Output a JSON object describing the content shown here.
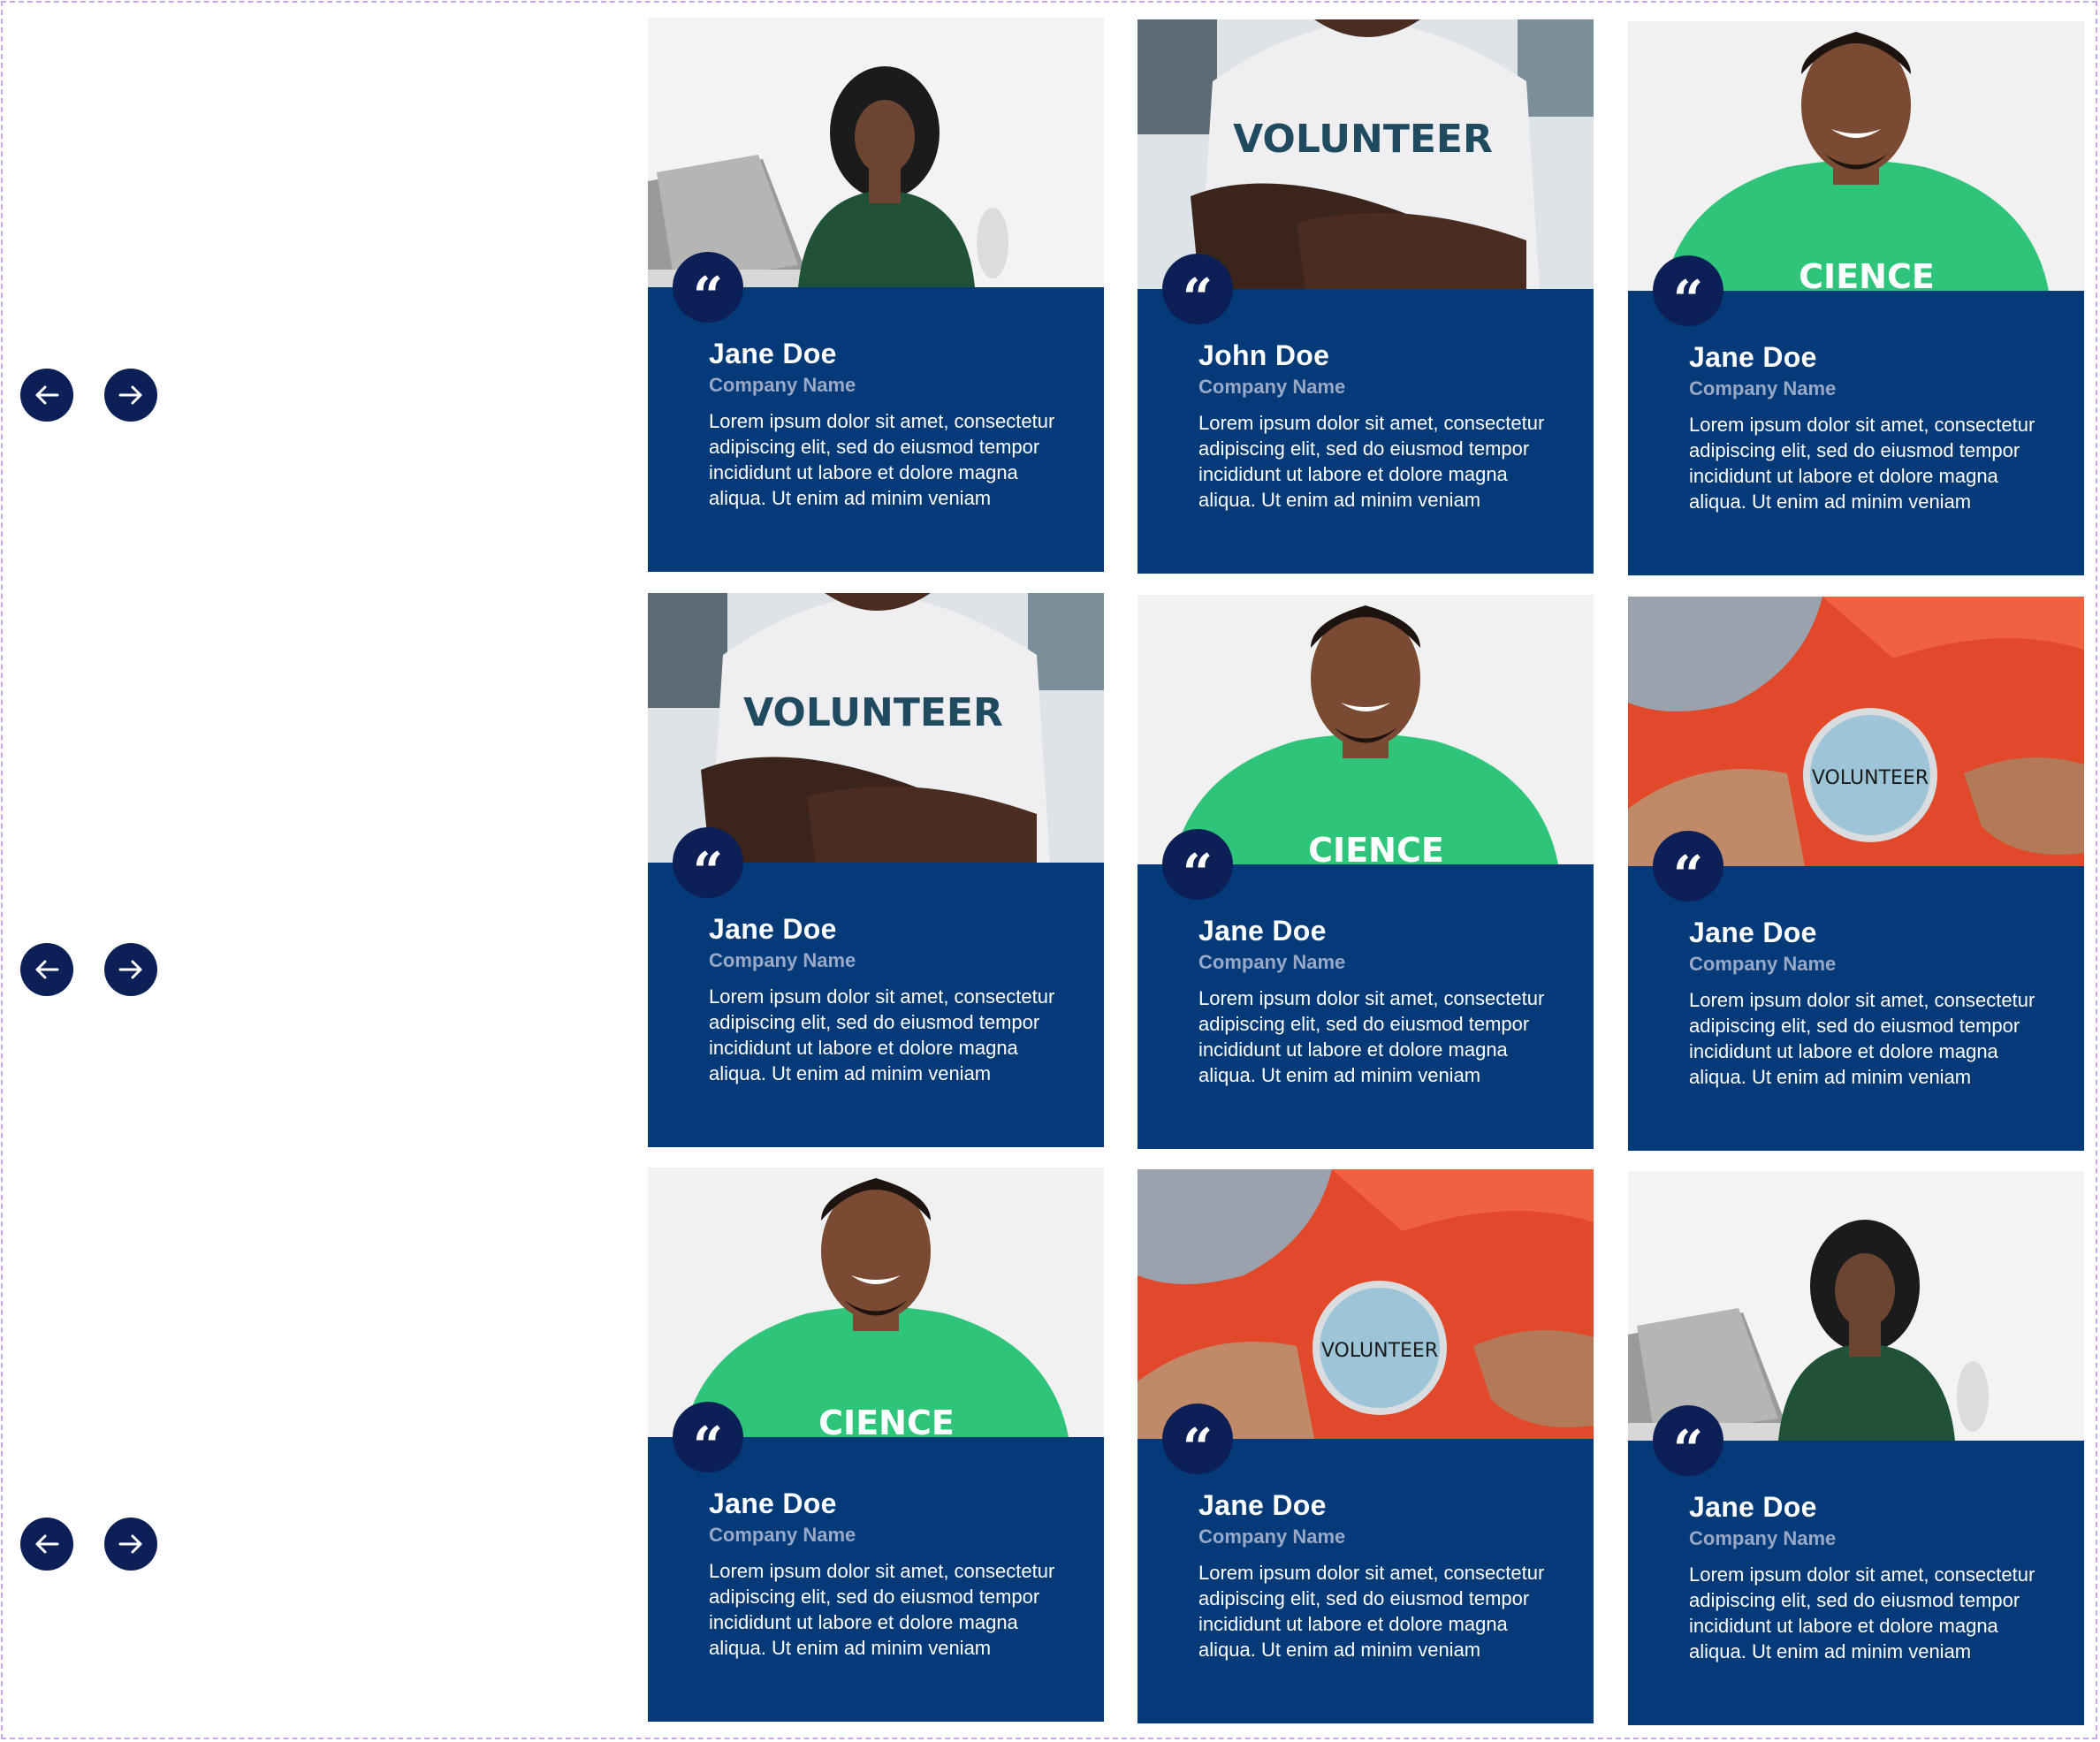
{
  "nav": {
    "prev_icon": "arrow-left-icon",
    "next_icon": "arrow-right-icon"
  },
  "quote_glyph": "“",
  "photos": {
    "woman_laptop": "woman-with-laptop-photo",
    "volunteer_shirt": "volunteer-shirt-photo",
    "science_shirt": "man-science-shirt-photo",
    "volunteer_badge": "volunteer-badge-photo"
  },
  "colors": {
    "card_bg": "#053a78",
    "badge_bg": "#0c1f57",
    "company": "#98a9c8"
  },
  "rows": [
    {
      "cards": [
        {
          "photo": "woman_laptop",
          "name": "Jane Doe",
          "company": "Company Name",
          "text": "Lorem ipsum dolor sit amet, consectetur adipiscing elit, sed do eiusmod tempor incididunt ut labore et dolore magna aliqua. Ut enim ad minim veniam"
        },
        {
          "photo": "volunteer_shirt",
          "name": "John Doe",
          "company": "Company Name",
          "text": "Lorem ipsum dolor sit amet, consectetur adipiscing elit, sed do eiusmod tempor incididunt ut labore et dolore magna aliqua. Ut enim ad minim veniam"
        },
        {
          "photo": "science_shirt",
          "name": "Jane Doe",
          "company": "Company Name",
          "text": "Lorem ipsum dolor sit amet, consectetur adipiscing elit, sed do eiusmod tempor incididunt ut labore et dolore magna aliqua. Ut enim ad minim veniam"
        }
      ]
    },
    {
      "cards": [
        {
          "photo": "volunteer_shirt",
          "name": "Jane Doe",
          "company": "Company Name",
          "text": "Lorem ipsum dolor sit amet, consectetur adipiscing elit, sed do eiusmod tempor incididunt ut labore et dolore magna aliqua. Ut enim ad minim veniam"
        },
        {
          "photo": "science_shirt",
          "name": "Jane Doe",
          "company": "Company Name",
          "text": "Lorem ipsum dolor sit amet, consectetur adipiscing elit, sed do eiusmod tempor incididunt ut labore et dolore magna aliqua. Ut enim ad minim veniam"
        },
        {
          "photo": "volunteer_badge",
          "name": "Jane Doe",
          "company": "Company Name",
          "text": "Lorem ipsum dolor sit amet, consectetur adipiscing elit, sed do eiusmod tempor incididunt ut labore et dolore magna aliqua. Ut enim ad minim veniam"
        }
      ]
    },
    {
      "cards": [
        {
          "photo": "science_shirt",
          "name": "Jane Doe",
          "company": "Company Name",
          "text": "Lorem ipsum dolor sit amet, consectetur adipiscing elit, sed do eiusmod tempor incididunt ut labore et dolore magna aliqua. Ut enim ad minim veniam"
        },
        {
          "photo": "volunteer_badge",
          "name": "Jane Doe",
          "company": "Company Name",
          "text": "Lorem ipsum dolor sit amet, consectetur adipiscing elit, sed do eiusmod tempor incididunt ut labore et dolore magna aliqua. Ut enim ad minim veniam"
        },
        {
          "photo": "woman_laptop",
          "name": "Jane Doe",
          "company": "Company Name",
          "text": "Lorem ipsum dolor sit amet, consectetur adipiscing elit, sed do eiusmod tempor incididunt ut labore et dolore magna aliqua. Ut enim ad minim veniam"
        }
      ]
    }
  ]
}
